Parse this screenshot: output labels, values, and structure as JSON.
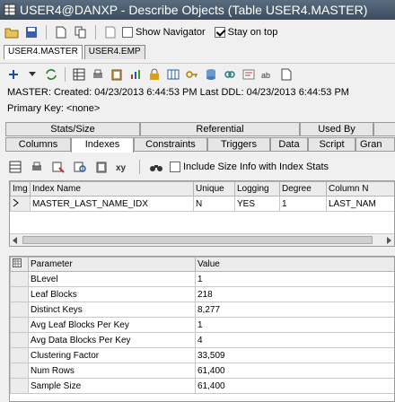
{
  "window": {
    "title": "USER4@DANXP - Describe Objects (Table USER4.MASTER)"
  },
  "toolbar1": {
    "show_navigator_label": "Show Navigator",
    "show_navigator_checked": false,
    "stay_on_top_label": "Stay on top",
    "stay_on_top_checked": true
  },
  "object_tabs": [
    {
      "label": "USER4.MASTER",
      "active": true
    },
    {
      "label": "USER4.EMP",
      "active": false
    }
  ],
  "info": {
    "line1": "MASTER:   Created: 04/23/2013 6:44:53 PM   Last DDL: 04/23/2013 6:44:53 PM",
    "line2": "Primary Key:  <none>"
  },
  "tabs_row1": [
    "Stats/Size",
    "Referential",
    "Used By"
  ],
  "tabs_row2": [
    "Columns",
    "Indexes",
    "Constraints",
    "Triggers",
    "Data",
    "Script",
    "Gran"
  ],
  "active_tab": "Indexes",
  "index_toolbar": {
    "include_size_label": "Include Size Info with Index Stats",
    "include_size_checked": false
  },
  "index_grid": {
    "columns": [
      "Img",
      "Index Name",
      "Unique",
      "Logging",
      "Degree",
      "Column N"
    ],
    "rows": [
      {
        "index_name": "MASTER_LAST_NAME_IDX",
        "unique": "N",
        "logging": "YES",
        "degree": "1",
        "column": "LAST_NAM"
      }
    ]
  },
  "param_grid": {
    "columns": [
      "Parameter",
      "Value"
    ],
    "rows": [
      {
        "parameter": "BLevel",
        "value": "1"
      },
      {
        "parameter": "Leaf Blocks",
        "value": "218"
      },
      {
        "parameter": "Distinct Keys",
        "value": "8,277"
      },
      {
        "parameter": "Avg Leaf Blocks Per Key",
        "value": "1"
      },
      {
        "parameter": "Avg Data Blocks Per Key",
        "value": "4"
      },
      {
        "parameter": "Clustering Factor",
        "value": "33,509"
      },
      {
        "parameter": "Num Rows",
        "value": "61,400"
      },
      {
        "parameter": "Sample Size",
        "value": "61,400"
      }
    ]
  }
}
